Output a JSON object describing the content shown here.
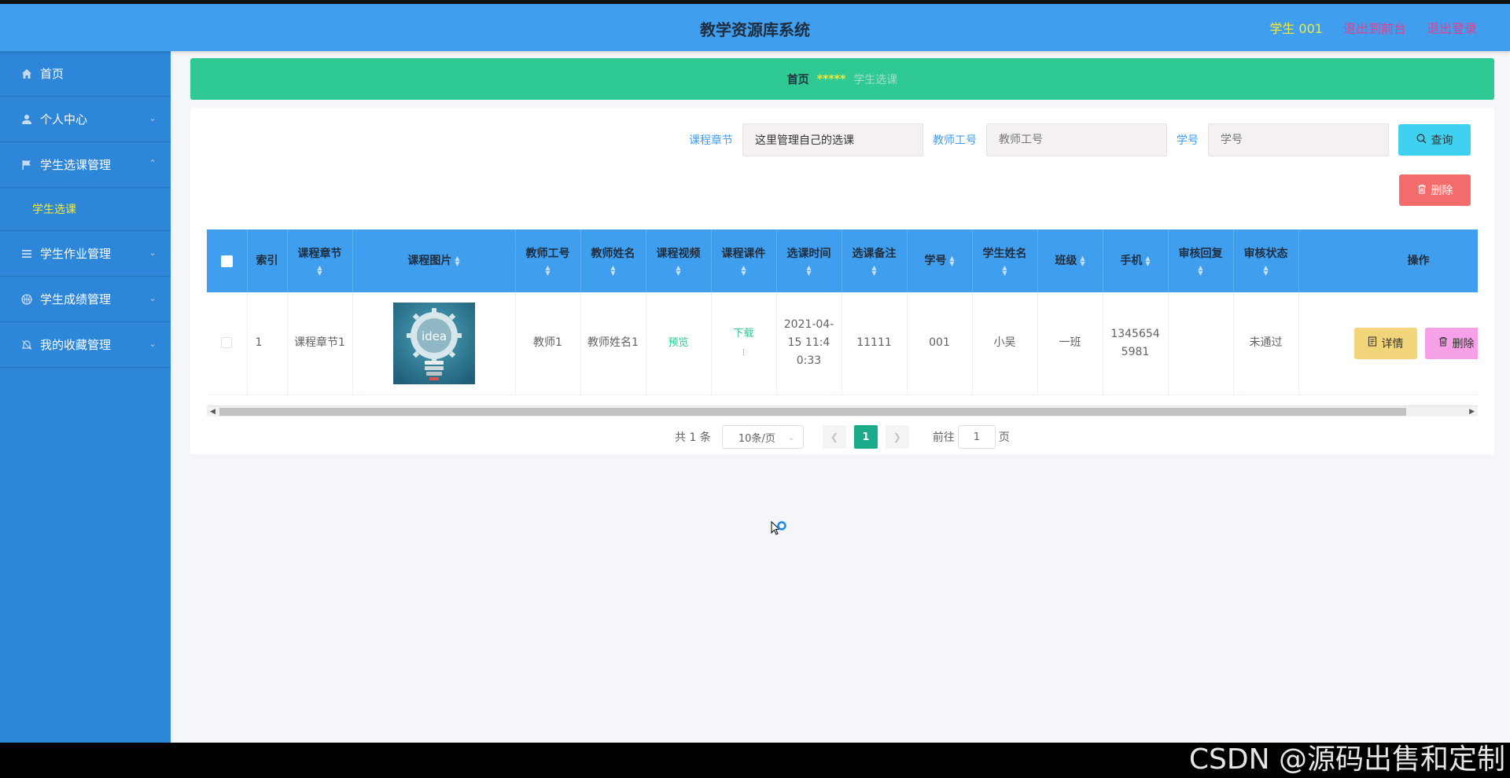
{
  "header": {
    "title": "教学资源库系统",
    "user": "学生 001",
    "links": [
      "退出到前台",
      "退出登录"
    ]
  },
  "sidebar": {
    "items": [
      {
        "label": "首页",
        "icon": "home-icon"
      },
      {
        "label": "个人中心",
        "icon": "user-icon"
      },
      {
        "label": "学生选课管理",
        "icon": "flag-icon"
      },
      {
        "label": "学生作业管理",
        "icon": "list-icon"
      },
      {
        "label": "学生成绩管理",
        "icon": "basketball-icon"
      },
      {
        "label": "我的收藏管理",
        "icon": "bell-off-icon"
      }
    ],
    "submenu": "学生选课"
  },
  "breadcrumb": {
    "home": "首页",
    "separator": "*****",
    "current": "学生选课"
  },
  "search": {
    "course_label": "课程章节",
    "course_value": "这里管理自己的选课",
    "teacher_label": "教师工号",
    "teacher_placeholder": "教师工号",
    "student_label": "学号",
    "student_placeholder": "学号",
    "query_button": "查询",
    "delete_button": "删除"
  },
  "table": {
    "headers": [
      "索引",
      "课程章节",
      "课程图片",
      "教师工号",
      "教师姓名",
      "课程视频",
      "课程课件",
      "选课时间",
      "选课备注",
      "学号",
      "学生姓名",
      "班级",
      "手机",
      "审核回复",
      "审核状态",
      "操作"
    ],
    "rows": [
      {
        "index": "1",
        "chapter": "课程章节1",
        "image_text": "idea",
        "teacher_no": "教师1",
        "teacher_name": "教师姓名1",
        "video": "预览",
        "courseware": "下载",
        "time": "2021-04-15 11:40:33",
        "remark": "11111",
        "student_no": "001",
        "student_name": "小吴",
        "class": "一班",
        "phone": "13456545981",
        "reply": "",
        "status": "未通过",
        "detail_button": "详情",
        "delete_button": "删除"
      }
    ]
  },
  "pagination": {
    "total": "共 1 条",
    "page_size": "10条/页",
    "current_page": "1",
    "goto_label": "前往",
    "goto_value": "1",
    "page_unit": "页"
  },
  "watermark": "CSDN @源码出售和定制",
  "colors": {
    "header": "#409eef",
    "sidebar": "#2d86d8",
    "breadcrumb": "#2fc993",
    "accent_yellow": "#f3ea3a",
    "accent_pink": "#e83e8c"
  }
}
